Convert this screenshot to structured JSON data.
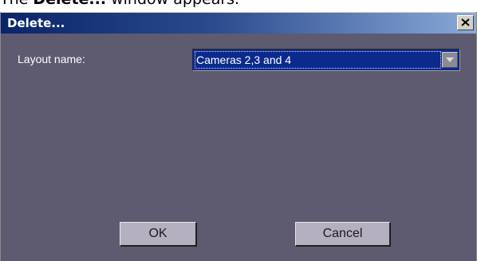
{
  "caption": {
    "prefix": "The ",
    "bold": "Delete...",
    "suffix": " window appears."
  },
  "window": {
    "title": "Delete...",
    "close_icon": "close-icon"
  },
  "form": {
    "layout_label": "Layout name:",
    "layout_value": "Cameras 2,3 and 4",
    "dropdown_icon": "chevron-down-icon"
  },
  "buttons": {
    "ok": "OK",
    "cancel": "Cancel"
  },
  "colors": {
    "titlebar": "#0a246a",
    "dialog_background": "#5e5a70",
    "selection": "#0b2a8c"
  }
}
